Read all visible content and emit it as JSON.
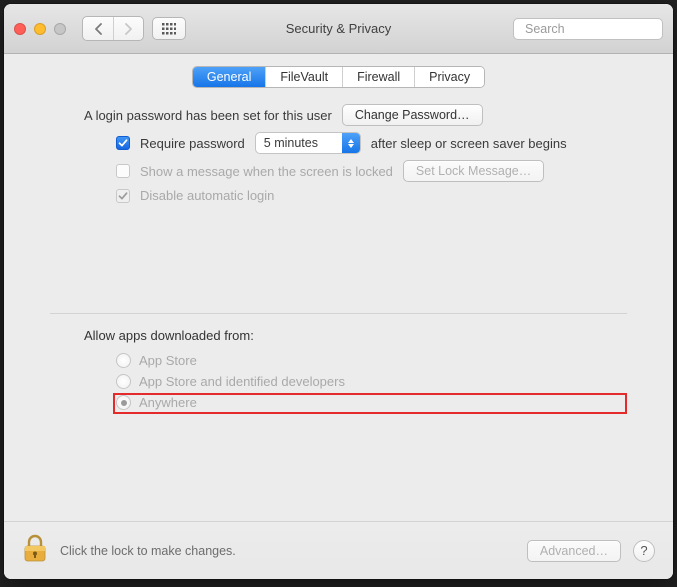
{
  "window": {
    "title": "Security & Privacy"
  },
  "search": {
    "placeholder": "Search"
  },
  "tabs": [
    {
      "id": "general",
      "label": "General",
      "active": true
    },
    {
      "id": "filevault",
      "label": "FileVault",
      "active": false
    },
    {
      "id": "firewall",
      "label": "Firewall",
      "active": false
    },
    {
      "id": "privacy",
      "label": "Privacy",
      "active": false
    }
  ],
  "login_password": {
    "text": "A login password has been set for this user",
    "change_button": "Change Password…"
  },
  "require_password": {
    "checked": true,
    "prefix": "Require password",
    "delay_selected": "5 minutes",
    "suffix": "after sleep or screen saver begins"
  },
  "show_message": {
    "checked": false,
    "enabled": false,
    "label": "Show a message when the screen is locked",
    "button": "Set Lock Message…"
  },
  "disable_autologin": {
    "checked": true,
    "enabled": false,
    "label": "Disable automatic login"
  },
  "allow_apps": {
    "heading": "Allow apps downloaded from:",
    "enabled": false,
    "options": [
      {
        "id": "app-store",
        "label": "App Store",
        "selected": false
      },
      {
        "id": "identified",
        "label": "App Store and identified developers",
        "selected": false
      },
      {
        "id": "anywhere",
        "label": "Anywhere",
        "selected": true
      }
    ]
  },
  "footer": {
    "lock_text": "Click the lock to make changes.",
    "advanced": "Advanced…",
    "help": "?"
  }
}
